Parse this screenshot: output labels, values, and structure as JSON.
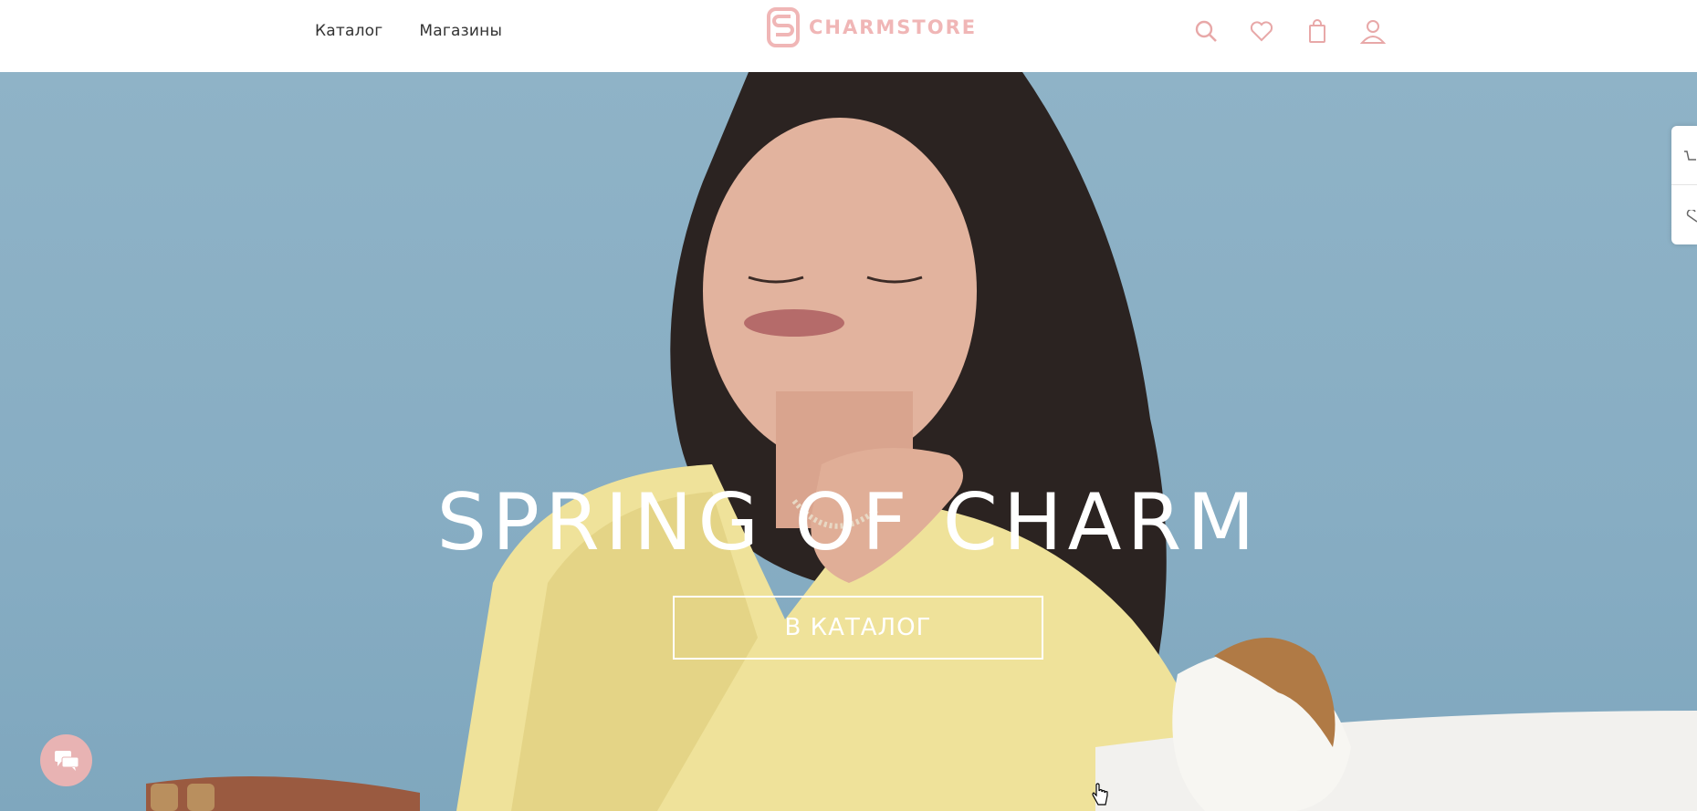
{
  "header": {
    "nav": [
      {
        "label": "Каталог"
      },
      {
        "label": "Магазины"
      }
    ],
    "logo_text": "CHARMSTORE",
    "icons": [
      "search-icon",
      "heart-icon",
      "cart-icon",
      "user-icon"
    ],
    "brand_color": "#f0b6b6"
  },
  "hero": {
    "title": "SPRING OF CHARM",
    "button_label": "В КАТАЛОГ",
    "bg_color": "#8fb3c7"
  },
  "side_panel": {
    "icons": [
      "cart-icon",
      "heart-icon"
    ]
  },
  "chat": {
    "icon": "chat-icon",
    "color": "#e8b3b3"
  }
}
